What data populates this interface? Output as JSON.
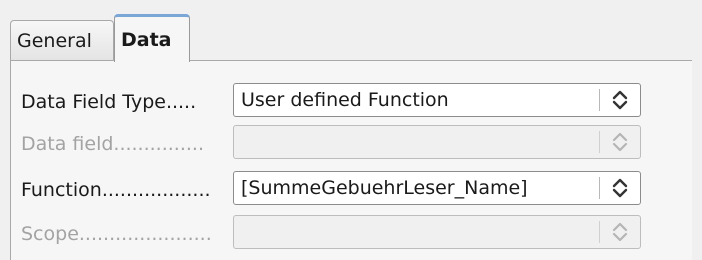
{
  "tabs": [
    {
      "label": "General"
    },
    {
      "label": "Data"
    }
  ],
  "fields": [
    {
      "label": "Data Field Type.....",
      "value": "User defined Function"
    },
    {
      "label": "Data field...............",
      "value": ""
    },
    {
      "label": "Function..................",
      "value": "[SummeGebuehrLeser_Name]"
    },
    {
      "label": "Scope......................",
      "value": ""
    }
  ],
  "icons": {
    "spinner": "up-down-chevron-icon"
  }
}
